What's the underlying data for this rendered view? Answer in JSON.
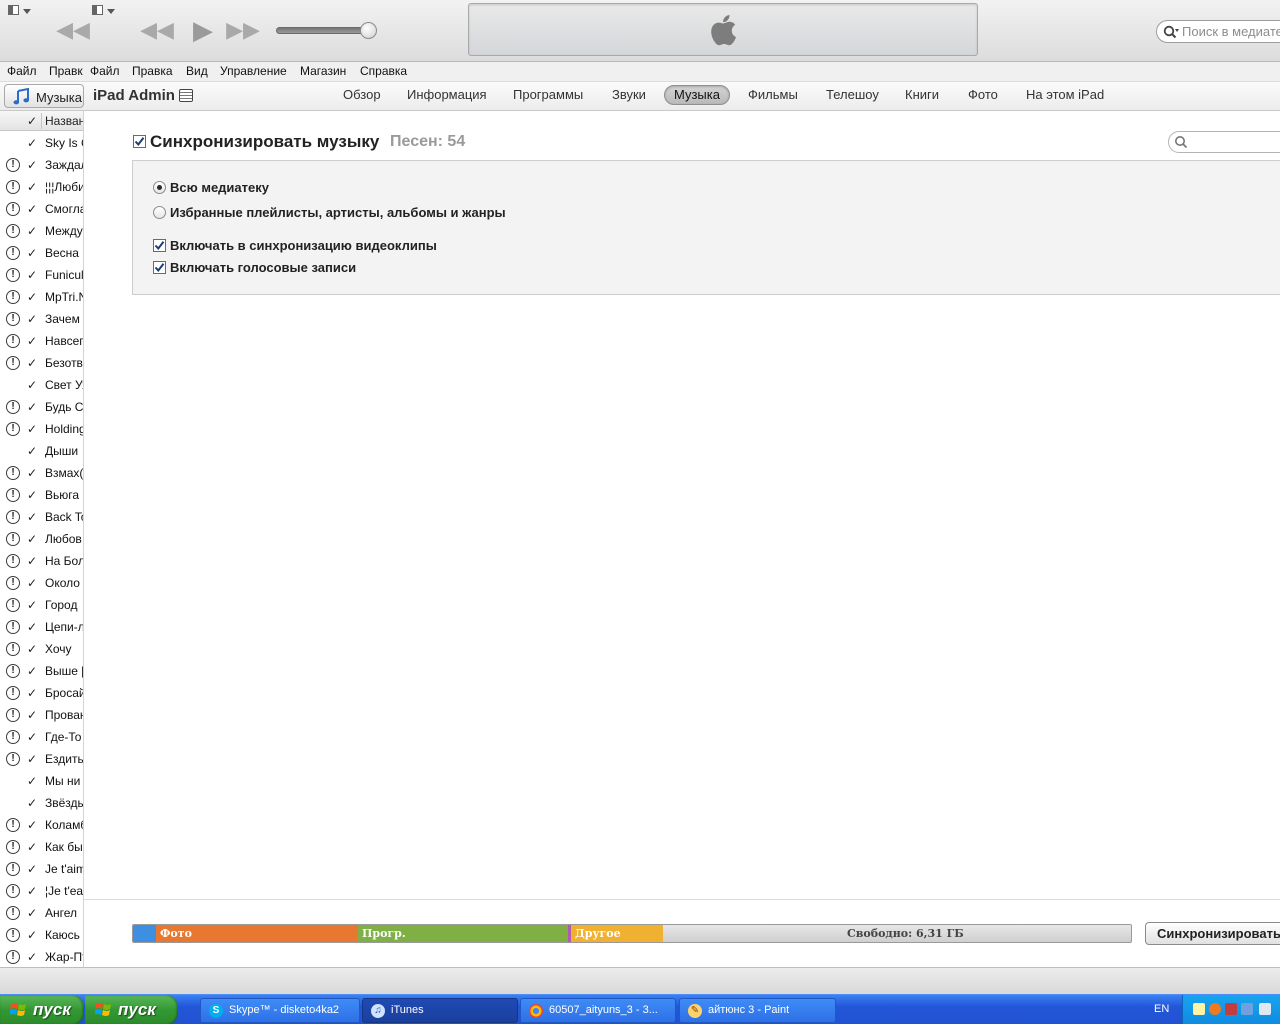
{
  "toolbar": {
    "search_placeholder": "Поиск в медиатеке",
    "rewind_icon": "rewind-icon",
    "play_icon": "play-icon",
    "forward_icon": "fast-forward-icon"
  },
  "menu": [
    "Файл",
    "Правк",
    "Файл",
    "Правка",
    "Вид",
    "Управление",
    "Магазин",
    "Справка"
  ],
  "device": {
    "library_label": "Музыка",
    "name": "iPad Admin",
    "tabs": [
      {
        "label": "Обзор",
        "active": false
      },
      {
        "label": "Информация",
        "active": false
      },
      {
        "label": "Программы",
        "active": false
      },
      {
        "label": "Звуки",
        "active": false
      },
      {
        "label": "Музыка",
        "active": true
      },
      {
        "label": "Фильмы",
        "active": false
      },
      {
        "label": "Телешоу",
        "active": false
      },
      {
        "label": "Книги",
        "active": false
      },
      {
        "label": "Фото",
        "active": false
      },
      {
        "label": "На этом iPad",
        "active": false
      }
    ]
  },
  "songlist": {
    "header_check": "✓",
    "header_title": "Назван",
    "rows": [
      {
        "warn": false,
        "name": "Sky Is C"
      },
      {
        "warn": true,
        "name": "Заждал"
      },
      {
        "warn": true,
        "name": "¦¦¦Люби"
      },
      {
        "warn": true,
        "name": "Смогла"
      },
      {
        "warn": true,
        "name": "Между"
      },
      {
        "warn": true,
        "name": "Весна"
      },
      {
        "warn": true,
        "name": "Funicul"
      },
      {
        "warn": true,
        "name": "MpTri.N"
      },
      {
        "warn": true,
        "name": "Зачем"
      },
      {
        "warn": true,
        "name": "Навсег"
      },
      {
        "warn": true,
        "name": "Безотв"
      },
      {
        "warn": false,
        "name": "Свет Ух"
      },
      {
        "warn": true,
        "name": "Будь С"
      },
      {
        "warn": true,
        "name": "Holding"
      },
      {
        "warn": false,
        "name": "Дыши"
      },
      {
        "warn": true,
        "name": "Взмах(2"
      },
      {
        "warn": true,
        "name": "Вьюга"
      },
      {
        "warn": true,
        "name": "Back To"
      },
      {
        "warn": true,
        "name": "Любов"
      },
      {
        "warn": true,
        "name": "На Бол"
      },
      {
        "warn": true,
        "name": "Около"
      },
      {
        "warn": true,
        "name": "Город"
      },
      {
        "warn": true,
        "name": "Цепи-л"
      },
      {
        "warn": true,
        "name": "Хочу"
      },
      {
        "warn": true,
        "name": "Выше ["
      },
      {
        "warn": true,
        "name": "Бросай"
      },
      {
        "warn": true,
        "name": "Прован"
      },
      {
        "warn": true,
        "name": "Где-То"
      },
      {
        "warn": true,
        "name": "Ездить"
      },
      {
        "warn": false,
        "name": "Мы ни"
      },
      {
        "warn": false,
        "name": "Звёзды"
      },
      {
        "warn": true,
        "name": "Коламб"
      },
      {
        "warn": true,
        "name": "Как бы"
      },
      {
        "warn": true,
        "name": "Je t'aim"
      },
      {
        "warn": true,
        "name": "¦Je t'ear"
      },
      {
        "warn": true,
        "name": "Ангел"
      },
      {
        "warn": true,
        "name": "Каюсь"
      },
      {
        "warn": true,
        "name": "Жар-Пт"
      }
    ]
  },
  "main": {
    "sync_title": "Синхронизировать музыку",
    "song_count": "Песен: 54",
    "options": {
      "all_library": "Всю медиатеку",
      "selected": "Избранные плейлисты, артисты, альбомы и жанры",
      "include_videos": "Включать в синхронизацию видеоклипы",
      "include_voice": "Включать голосовые записи"
    }
  },
  "capacity": {
    "segments": [
      {
        "label": "",
        "fraction": 0.023,
        "color": "#3f8fe0"
      },
      {
        "label": "Фото",
        "fraction": 0.202,
        "color": "#e8782f"
      },
      {
        "label": "Прогр.",
        "fraction": 0.21,
        "color": "#7fb043"
      },
      {
        "label": "",
        "fraction": 0.003,
        "color": "#b05ab0"
      },
      {
        "label": "Другое",
        "fraction": 0.092,
        "color": "#f0b132"
      }
    ],
    "free_label": "Свободно: 6,31 ГБ",
    "sync_button": "Синхронизировать"
  },
  "taskbar": {
    "start_label": "пуск",
    "tasks": [
      {
        "label": "Skype™ - disketo4ka2",
        "icon": "S",
        "active": false
      },
      {
        "label": "iTunes",
        "icon": "♫",
        "active": true
      },
      {
        "label": "60507_aityuns_3 - 3...",
        "icon": "●",
        "active": false
      },
      {
        "label": "айтюнс 3 - Paint",
        "icon": "✎",
        "active": false
      }
    ],
    "lang": "EN"
  }
}
